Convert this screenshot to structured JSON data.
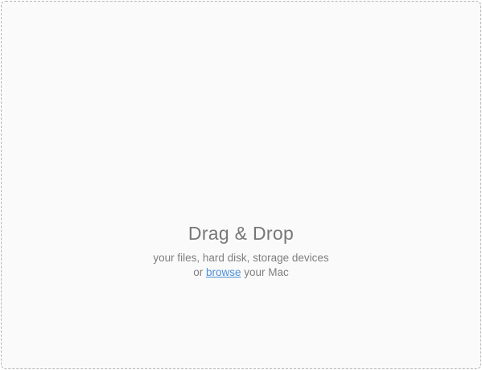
{
  "dropzone": {
    "title": "Drag & Drop",
    "subtitle": "your files, hard disk, storage devices",
    "browse_prefix": "or ",
    "browse_link": "browse",
    "browse_suffix": " your Mac"
  },
  "colors": {
    "background": "#fafafa",
    "border": "#b3b3b3",
    "text": "#7a7a7a",
    "link": "#4a90d9"
  }
}
